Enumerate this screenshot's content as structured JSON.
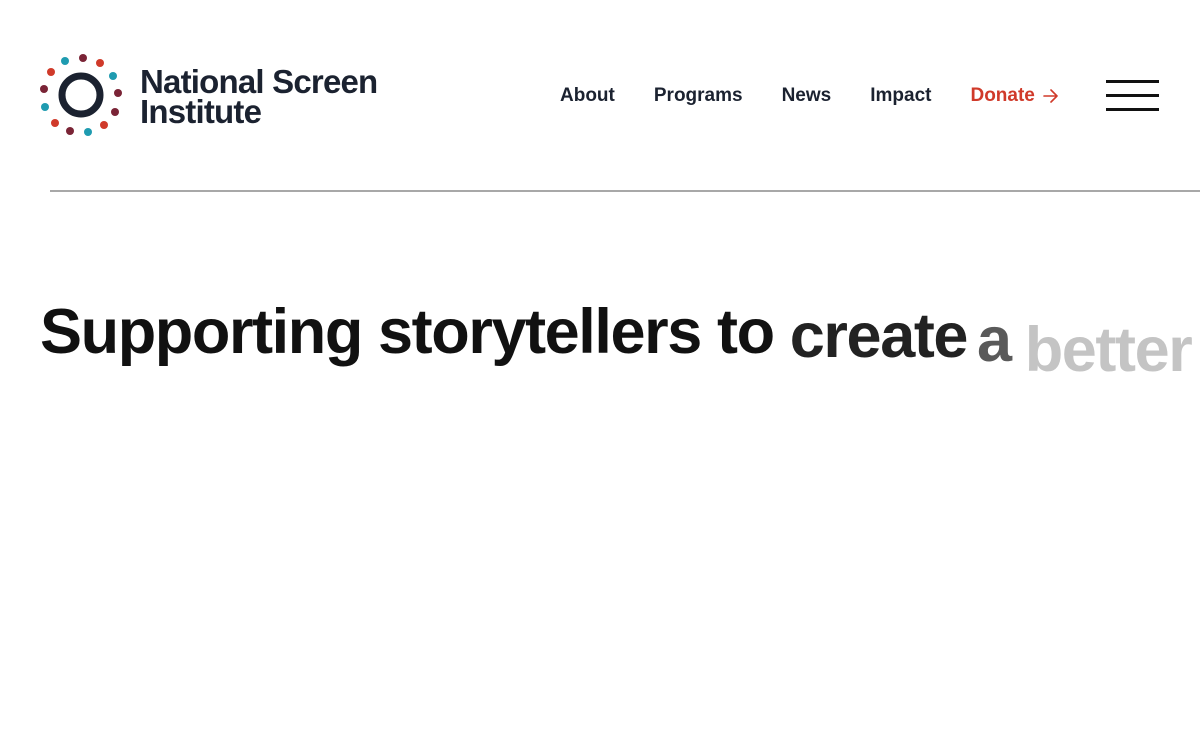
{
  "brand": {
    "name_line1": "National Screen",
    "name_line2": "Institute",
    "dot_colors": [
      "#1f9bb0",
      "#d03a2a",
      "#7a2436",
      "#2aa0b8"
    ],
    "ring_color": "#1b2230"
  },
  "nav": {
    "items": [
      {
        "label": "About"
      },
      {
        "label": "Programs"
      },
      {
        "label": "News"
      },
      {
        "label": "Impact"
      }
    ],
    "donate_label": "Donate",
    "donate_icon": "arrow-right-icon",
    "donate_color": "#d03a2a",
    "menu_icon": "hamburger-icon"
  },
  "hero": {
    "words": [
      "Supporting",
      "storytellers",
      "to",
      "create",
      "a",
      "better"
    ]
  }
}
